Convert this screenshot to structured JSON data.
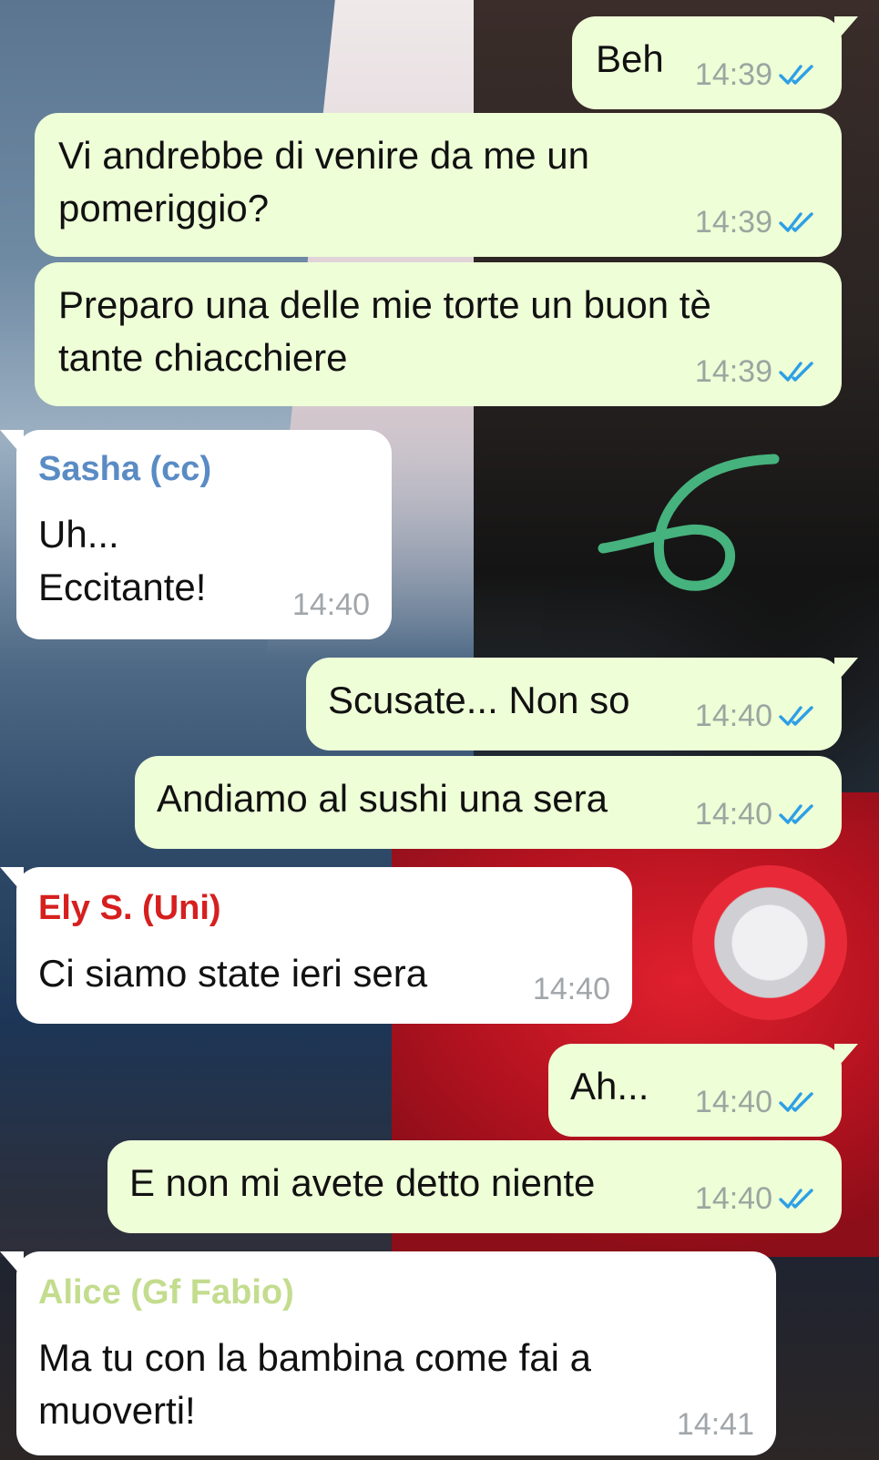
{
  "colors": {
    "outgoing_bubble": "#eefed7",
    "incoming_bubble": "#ffffff",
    "read_check": "#2d9fe6",
    "annotation_stroke": "#46b27d"
  },
  "icons": {
    "read_receipt": "double-check-icon"
  },
  "messages": [
    {
      "direction": "outgoing",
      "text": "Beh",
      "time": "14:39",
      "read": true
    },
    {
      "direction": "outgoing",
      "text": "Vi andrebbe di venire da me un\npomeriggio?",
      "time": "14:39",
      "read": true
    },
    {
      "direction": "outgoing",
      "text": "Preparo una delle mie torte un buon tè\ntante chiacchiere",
      "time": "14:39",
      "read": true
    },
    {
      "direction": "incoming",
      "sender": "Sasha (cc)",
      "sender_color": "#5a8bc4",
      "text": "Uh...\nEccitante!",
      "time": "14:40"
    },
    {
      "direction": "outgoing",
      "text": "Scusate... Non so",
      "time": "14:40",
      "read": true
    },
    {
      "direction": "outgoing",
      "text": "Andiamo al sushi una sera",
      "time": "14:40",
      "read": true
    },
    {
      "direction": "incoming",
      "sender": "Ely S. (Uni)",
      "sender_color": "#d61f1f",
      "text": "Ci siamo state ieri sera",
      "time": "14:40"
    },
    {
      "direction": "outgoing",
      "text": "Ah...",
      "time": "14:40",
      "read": true
    },
    {
      "direction": "outgoing",
      "text": "E non mi avete detto niente",
      "time": "14:40",
      "read": true
    },
    {
      "direction": "incoming",
      "sender": "Alice (Gf Fabio)",
      "sender_color": "#c3dc8e",
      "text": "Ma tu con la bambina come fai a\nmuoverti!",
      "time": "14:41"
    }
  ]
}
